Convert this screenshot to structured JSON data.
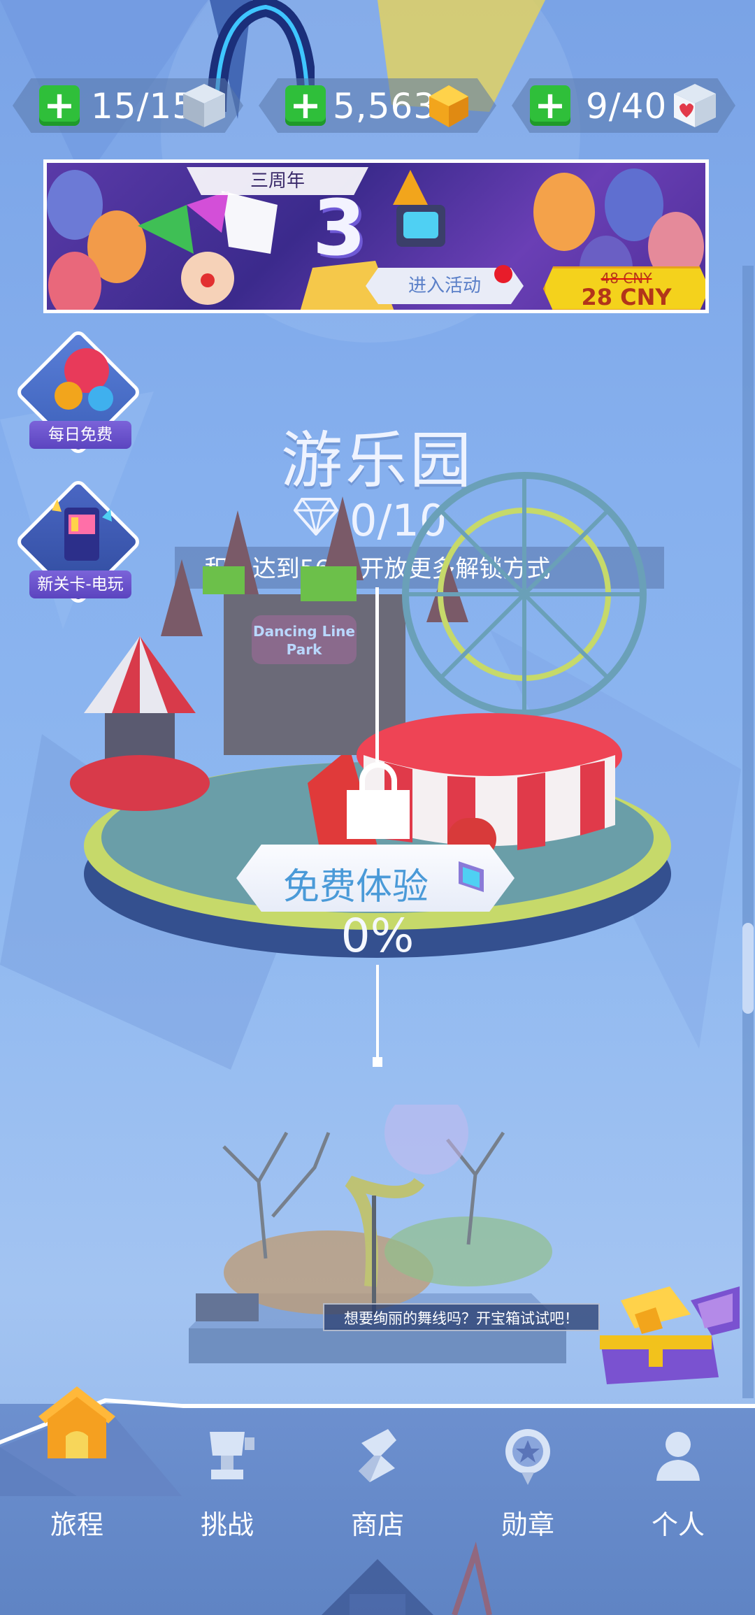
{
  "currency": {
    "blocks": "15/15",
    "gems": "5,563",
    "hearts": "9/40",
    "plus": "+"
  },
  "banner": {
    "title": "三周年",
    "enter_label": "进入活动",
    "price_old": "48 CNY",
    "price_new": "28 CNY"
  },
  "side": {
    "daily_free": "每日免费",
    "new_level": "新关卡-电玩"
  },
  "level": {
    "title": "游乐园",
    "gem_progress": "0/10",
    "unlock_hint": "积分达到5600开放更多解锁方式",
    "park_sign": "Dancing Line Park",
    "trial_label": "免费体验",
    "percent": "0%"
  },
  "tip": "想要绚丽的舞线吗？开宝箱试试吧！",
  "nav": {
    "journey": "旅程",
    "challenge": "挑战",
    "shop": "商店",
    "medal": "勋章",
    "profile": "个人"
  },
  "colors": {
    "accent_green": "#2fbf3a",
    "price_yellow": "#f4d21c",
    "trial_blue": "#4a9ad8",
    "house_orange": "#f5a020"
  }
}
